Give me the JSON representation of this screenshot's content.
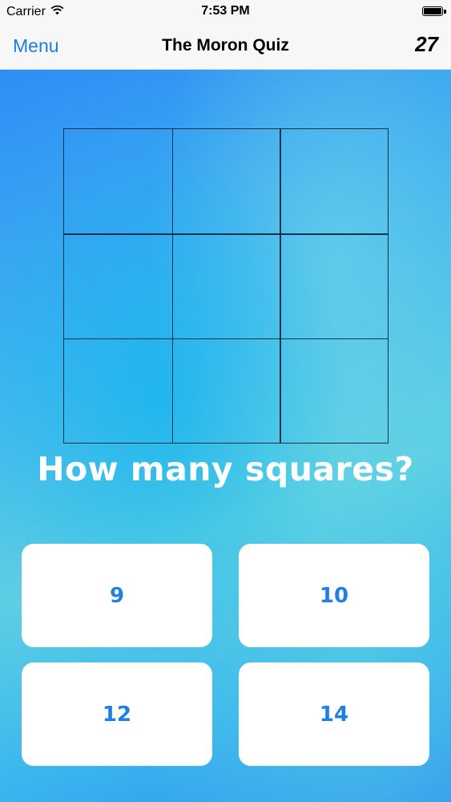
{
  "status_bar": {
    "carrier": "Carrier",
    "time": "7:53 PM",
    "wifi_icon": "wifi-icon",
    "battery_icon": "battery-icon",
    "battery_level": 1.0
  },
  "nav": {
    "menu_label": "Menu",
    "title": "The Moron Quiz",
    "score": "27"
  },
  "puzzle": {
    "grid_rows": 3,
    "grid_cols": 3,
    "question": "How many squares?"
  },
  "answers": [
    "9",
    "10",
    "12",
    "14"
  ],
  "colors": {
    "accent": "#1a7fe0",
    "answer_text": "#1e7fe6",
    "background_top": "#2d8ef5",
    "background_mid": "#5ccfe3",
    "grid_line": "#0f2f4a"
  }
}
